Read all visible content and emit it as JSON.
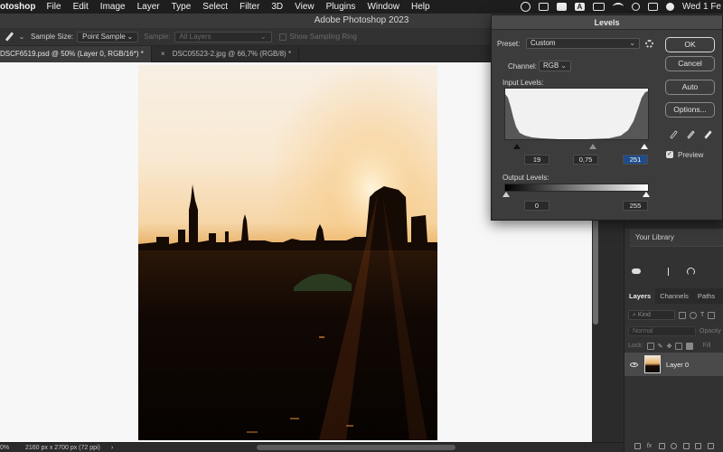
{
  "menubar": {
    "app_name": "otoshop",
    "items": [
      "File",
      "Edit",
      "Image",
      "Layer",
      "Type",
      "Select",
      "Filter",
      "3D",
      "View",
      "Plugins",
      "Window",
      "Help"
    ],
    "clock": "Wed 1 Fe"
  },
  "window_title": "Adobe Photoshop 2023",
  "options_bar": {
    "sample_size_label": "Sample Size:",
    "sample_size_value": "Point Sample",
    "sample_label": "Sample:",
    "sample_value": "All Layers",
    "sampling_ring_label": "Show Sampling Ring"
  },
  "tabs": [
    {
      "close": "×",
      "label": "DSCF6519.psd @ 50% (Layer 0, RGB/16*) *"
    },
    {
      "close": "×",
      "label": "DSC05523-2.jpg @ 66,7% (RGB/8) *"
    }
  ],
  "status": {
    "zoom": "0%",
    "doc_size": "2160 px x 2700 px (72 ppi)",
    "chevron": "›"
  },
  "levels": {
    "title": "Levels",
    "preset_label": "Preset:",
    "preset_value": "Custom",
    "channel_label": "Channel:",
    "channel_value": "RGB",
    "input_levels_label": "Input Levels:",
    "input_black": "19",
    "input_gamma": "0,75",
    "input_white": "251",
    "output_levels_label": "Output Levels:",
    "output_black": "0",
    "output_white": "255",
    "buttons": {
      "ok": "OK",
      "cancel": "Cancel",
      "auto": "Auto",
      "options": "Options..."
    },
    "preview_label": "Preview",
    "preview_checked": true
  },
  "right_panel": {
    "library_name": "Your Library",
    "layer_tabs": [
      "Layers",
      "Channels",
      "Paths"
    ],
    "kind_filter": "Kind",
    "blend_mode": "Normal",
    "opacity_label": "Opacity",
    "lock_label": "Lock:",
    "fill_label": "Fill",
    "layer_name": "Layer 0"
  }
}
